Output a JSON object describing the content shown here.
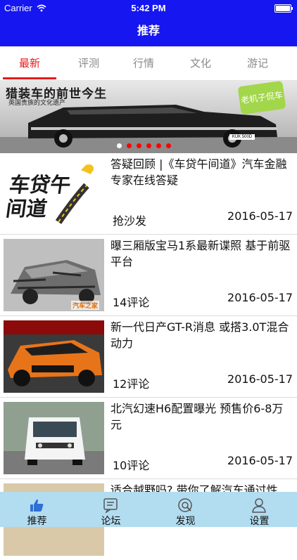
{
  "status_bar": {
    "carrier": "Carrier",
    "time": "5:42 PM"
  },
  "nav": {
    "title": "推荐"
  },
  "tabs": [
    {
      "label": "最新"
    },
    {
      "label": "评测"
    },
    {
      "label": "行情"
    },
    {
      "label": "文化"
    },
    {
      "label": "游记"
    }
  ],
  "banner": {
    "caption": "猎装车的前世今生",
    "subcaption": "英国贵族的文化遗产",
    "badge": "老机子侃车",
    "plate": "KUK 500D",
    "page_count": 6,
    "current_page": 1
  },
  "news": [
    {
      "title": "答疑回顾 |《车贷午间道》汽车金融专家在线答疑",
      "comments": "抢沙发",
      "date": "2016-05-17",
      "thumb_text": "车贷午间道"
    },
    {
      "title": "曝三厢版宝马1系最新谍照 基于前驱平台",
      "comments": "14评论",
      "date": "2016-05-17",
      "thumb_text": "汽车之家"
    },
    {
      "title": "新一代日产GT-R消息 或搭3.0T混合动力",
      "comments": "12评论",
      "date": "2016-05-17"
    },
    {
      "title": "北汽幻速H6配置曝光 预售价6-8万元",
      "comments": "10评论",
      "date": "2016-05-17"
    },
    {
      "title": "适合越野吗? 带你了解汽车通过性"
    }
  ],
  "tabbar": [
    {
      "label": "推荐",
      "icon": "thumbs-up-icon"
    },
    {
      "label": "论坛",
      "icon": "forum-icon"
    },
    {
      "label": "发现",
      "icon": "discover-icon"
    },
    {
      "label": "设置",
      "icon": "user-icon"
    }
  ],
  "colors": {
    "nav": "#1616f0",
    "accent": "#e51b1b",
    "tabbar": "#b2dcf0"
  }
}
